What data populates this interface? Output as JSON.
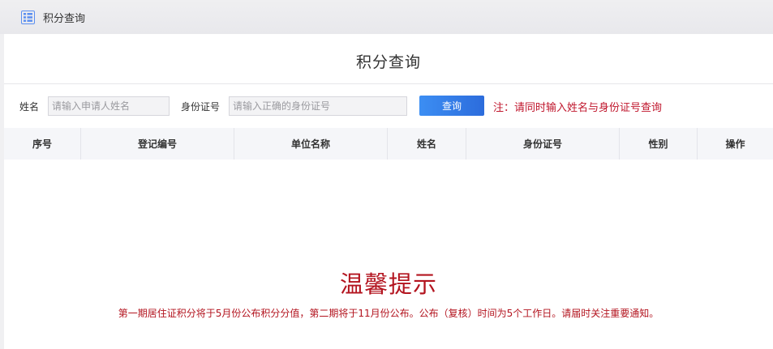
{
  "topbar": {
    "title": "积分查询",
    "icon": "list-menu-icon",
    "icon_color": "#5b8ff0"
  },
  "card": {
    "title": "积分查询"
  },
  "form": {
    "name_label": "姓名",
    "name_placeholder": "请输入申请人姓名",
    "name_value": "",
    "id_label": "身份证号",
    "id_placeholder": "请输入正确的身份证号",
    "id_value": "",
    "query_button": "查询",
    "note": "注：请同时输入姓名与身份证号查询"
  },
  "table": {
    "columns": [
      "序号",
      "登记编号",
      "单位名称",
      "姓名",
      "身份证号",
      "性别",
      "操作"
    ],
    "rows": []
  },
  "notice": {
    "title": "温馨提示",
    "text": "第一期居住证积分将于5月份公布积分分值，第二期将于11月份公布。公布（复核）时间为5个工作日。请届时关注重要通知。"
  },
  "colors": {
    "accent": "#3c8ef3",
    "notice_red": "#b3141f",
    "note_red": "#c0162c"
  }
}
